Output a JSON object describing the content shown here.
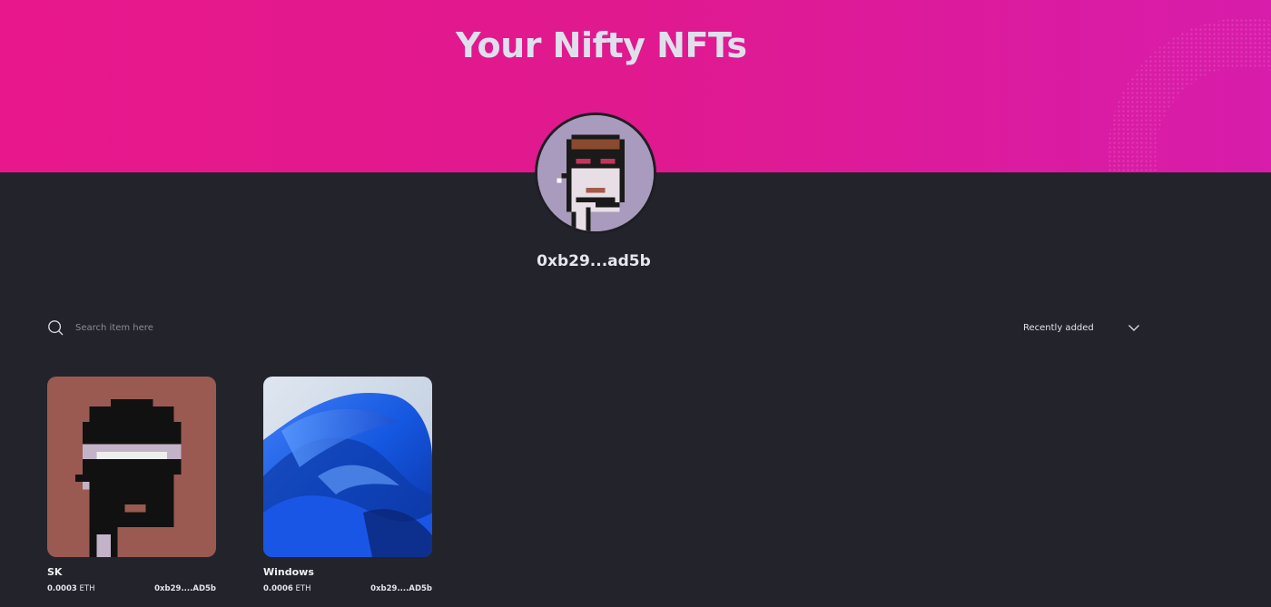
{
  "header": {
    "title": "Your Nifty NFTs"
  },
  "profile": {
    "address": "0xb29...ad5b"
  },
  "toolbar": {
    "search_placeholder": "Search item here",
    "sort_label": "Recently added"
  },
  "colors": {
    "banner_start": "#e8178b",
    "banner_end": "#d81cab",
    "background": "#23232b"
  },
  "nfts": [
    {
      "name": "SK",
      "price": "0.0003",
      "currency": "ETH",
      "owner": "0xb29....AD5b"
    },
    {
      "name": "Windows",
      "price": "0.0006",
      "currency": "ETH",
      "owner": "0xb29....AD5b"
    }
  ]
}
